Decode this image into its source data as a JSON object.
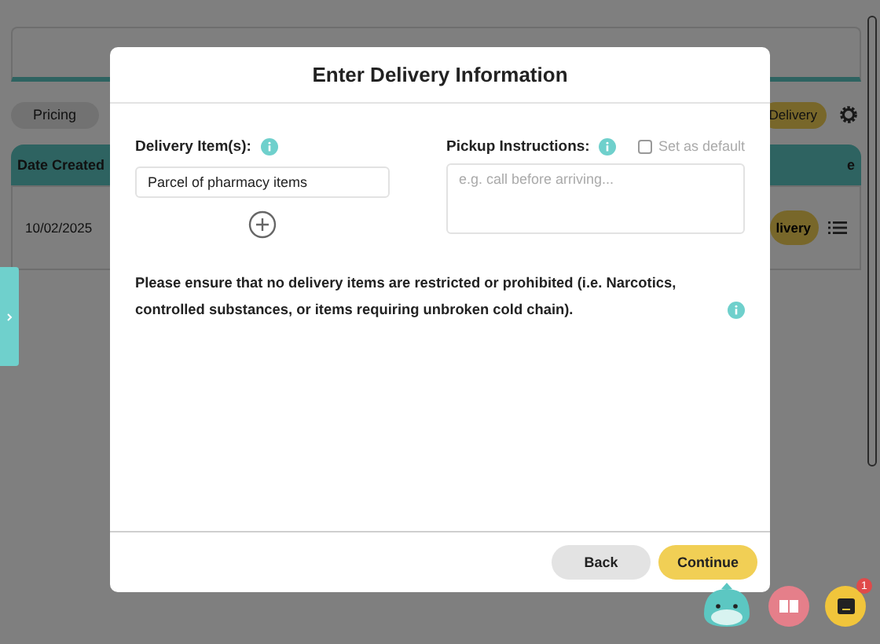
{
  "background": {
    "pricing_tab": "Pricing",
    "delivery_button": "Delivery",
    "table": {
      "columns": [
        "Date Created",
        "e"
      ],
      "rows": [
        {
          "date": "10/02/2025",
          "action": "livery"
        }
      ]
    }
  },
  "modal": {
    "title": "Enter Delivery Information",
    "delivery_items": {
      "label": "Delivery Item(s):",
      "items": [
        "Parcel of pharmacy items"
      ]
    },
    "pickup": {
      "label": "Pickup Instructions:",
      "placeholder": "e.g. call before arriving...",
      "set_as_default": {
        "label": "Set as default",
        "checked": false
      }
    },
    "notice": "Please ensure that no delivery items are restricted or prohibited (i.e. Narcotics, controlled substances, or items requiring unbroken cold chain).",
    "buttons": [
      {
        "label": "Back",
        "kind": "secondary"
      },
      {
        "label": "Continue",
        "kind": "primary"
      }
    ]
  },
  "chat_badge": "1"
}
